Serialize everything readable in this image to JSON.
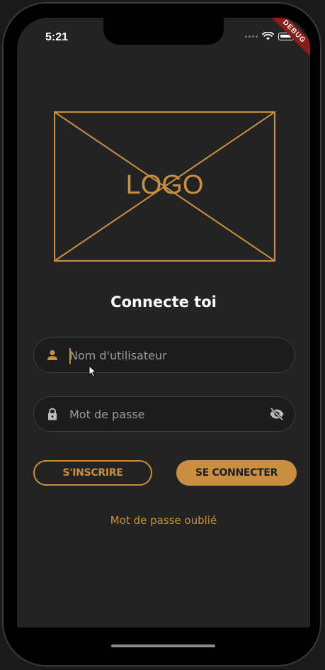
{
  "status_bar": {
    "time": "5:21",
    "icons": [
      "signal-dots-icon",
      "wifi-icon",
      "battery-icon"
    ]
  },
  "debug_ribbon": "DEBUG",
  "logo": {
    "placeholder_text": "LOGO"
  },
  "login": {
    "title": "Connecte toi",
    "username": {
      "placeholder": "Nom d'utilisateur",
      "value": "",
      "icon": "person-icon"
    },
    "password": {
      "placeholder": "Mot de passe",
      "value": "",
      "icon": "lock-icon",
      "toggle_icon": "eye-off-icon"
    },
    "register_label": "S'INSCRIRE",
    "login_label": "SE CONNECTER",
    "forgot_label": "Mot de passe oublié"
  },
  "colors": {
    "accent": "#c88f43",
    "background": "#232323",
    "field_background": "#1c1c1c",
    "text": "#ffffff",
    "debug_ribbon": "#8b1c1c"
  }
}
